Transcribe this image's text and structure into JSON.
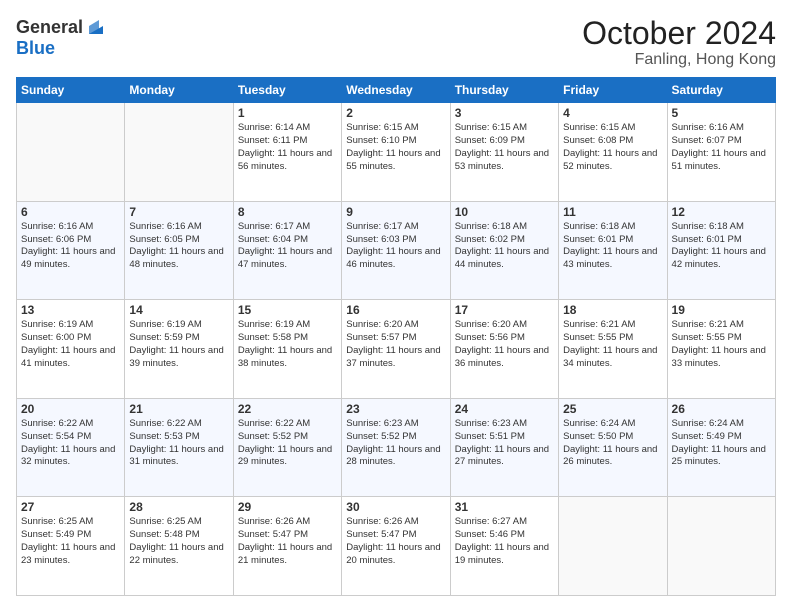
{
  "header": {
    "logo_general": "General",
    "logo_blue": "Blue",
    "month": "October 2024",
    "location": "Fanling, Hong Kong"
  },
  "days_of_week": [
    "Sunday",
    "Monday",
    "Tuesday",
    "Wednesday",
    "Thursday",
    "Friday",
    "Saturday"
  ],
  "weeks": [
    [
      {
        "day": "",
        "info": ""
      },
      {
        "day": "",
        "info": ""
      },
      {
        "day": "1",
        "info": "Sunrise: 6:14 AM\nSunset: 6:11 PM\nDaylight: 11 hours and 56 minutes."
      },
      {
        "day": "2",
        "info": "Sunrise: 6:15 AM\nSunset: 6:10 PM\nDaylight: 11 hours and 55 minutes."
      },
      {
        "day": "3",
        "info": "Sunrise: 6:15 AM\nSunset: 6:09 PM\nDaylight: 11 hours and 53 minutes."
      },
      {
        "day": "4",
        "info": "Sunrise: 6:15 AM\nSunset: 6:08 PM\nDaylight: 11 hours and 52 minutes."
      },
      {
        "day": "5",
        "info": "Sunrise: 6:16 AM\nSunset: 6:07 PM\nDaylight: 11 hours and 51 minutes."
      }
    ],
    [
      {
        "day": "6",
        "info": "Sunrise: 6:16 AM\nSunset: 6:06 PM\nDaylight: 11 hours and 49 minutes."
      },
      {
        "day": "7",
        "info": "Sunrise: 6:16 AM\nSunset: 6:05 PM\nDaylight: 11 hours and 48 minutes."
      },
      {
        "day": "8",
        "info": "Sunrise: 6:17 AM\nSunset: 6:04 PM\nDaylight: 11 hours and 47 minutes."
      },
      {
        "day": "9",
        "info": "Sunrise: 6:17 AM\nSunset: 6:03 PM\nDaylight: 11 hours and 46 minutes."
      },
      {
        "day": "10",
        "info": "Sunrise: 6:18 AM\nSunset: 6:02 PM\nDaylight: 11 hours and 44 minutes."
      },
      {
        "day": "11",
        "info": "Sunrise: 6:18 AM\nSunset: 6:01 PM\nDaylight: 11 hours and 43 minutes."
      },
      {
        "day": "12",
        "info": "Sunrise: 6:18 AM\nSunset: 6:01 PM\nDaylight: 11 hours and 42 minutes."
      }
    ],
    [
      {
        "day": "13",
        "info": "Sunrise: 6:19 AM\nSunset: 6:00 PM\nDaylight: 11 hours and 41 minutes."
      },
      {
        "day": "14",
        "info": "Sunrise: 6:19 AM\nSunset: 5:59 PM\nDaylight: 11 hours and 39 minutes."
      },
      {
        "day": "15",
        "info": "Sunrise: 6:19 AM\nSunset: 5:58 PM\nDaylight: 11 hours and 38 minutes."
      },
      {
        "day": "16",
        "info": "Sunrise: 6:20 AM\nSunset: 5:57 PM\nDaylight: 11 hours and 37 minutes."
      },
      {
        "day": "17",
        "info": "Sunrise: 6:20 AM\nSunset: 5:56 PM\nDaylight: 11 hours and 36 minutes."
      },
      {
        "day": "18",
        "info": "Sunrise: 6:21 AM\nSunset: 5:55 PM\nDaylight: 11 hours and 34 minutes."
      },
      {
        "day": "19",
        "info": "Sunrise: 6:21 AM\nSunset: 5:55 PM\nDaylight: 11 hours and 33 minutes."
      }
    ],
    [
      {
        "day": "20",
        "info": "Sunrise: 6:22 AM\nSunset: 5:54 PM\nDaylight: 11 hours and 32 minutes."
      },
      {
        "day": "21",
        "info": "Sunrise: 6:22 AM\nSunset: 5:53 PM\nDaylight: 11 hours and 31 minutes."
      },
      {
        "day": "22",
        "info": "Sunrise: 6:22 AM\nSunset: 5:52 PM\nDaylight: 11 hours and 29 minutes."
      },
      {
        "day": "23",
        "info": "Sunrise: 6:23 AM\nSunset: 5:52 PM\nDaylight: 11 hours and 28 minutes."
      },
      {
        "day": "24",
        "info": "Sunrise: 6:23 AM\nSunset: 5:51 PM\nDaylight: 11 hours and 27 minutes."
      },
      {
        "day": "25",
        "info": "Sunrise: 6:24 AM\nSunset: 5:50 PM\nDaylight: 11 hours and 26 minutes."
      },
      {
        "day": "26",
        "info": "Sunrise: 6:24 AM\nSunset: 5:49 PM\nDaylight: 11 hours and 25 minutes."
      }
    ],
    [
      {
        "day": "27",
        "info": "Sunrise: 6:25 AM\nSunset: 5:49 PM\nDaylight: 11 hours and 23 minutes."
      },
      {
        "day": "28",
        "info": "Sunrise: 6:25 AM\nSunset: 5:48 PM\nDaylight: 11 hours and 22 minutes."
      },
      {
        "day": "29",
        "info": "Sunrise: 6:26 AM\nSunset: 5:47 PM\nDaylight: 11 hours and 21 minutes."
      },
      {
        "day": "30",
        "info": "Sunrise: 6:26 AM\nSunset: 5:47 PM\nDaylight: 11 hours and 20 minutes."
      },
      {
        "day": "31",
        "info": "Sunrise: 6:27 AM\nSunset: 5:46 PM\nDaylight: 11 hours and 19 minutes."
      },
      {
        "day": "",
        "info": ""
      },
      {
        "day": "",
        "info": ""
      }
    ]
  ]
}
